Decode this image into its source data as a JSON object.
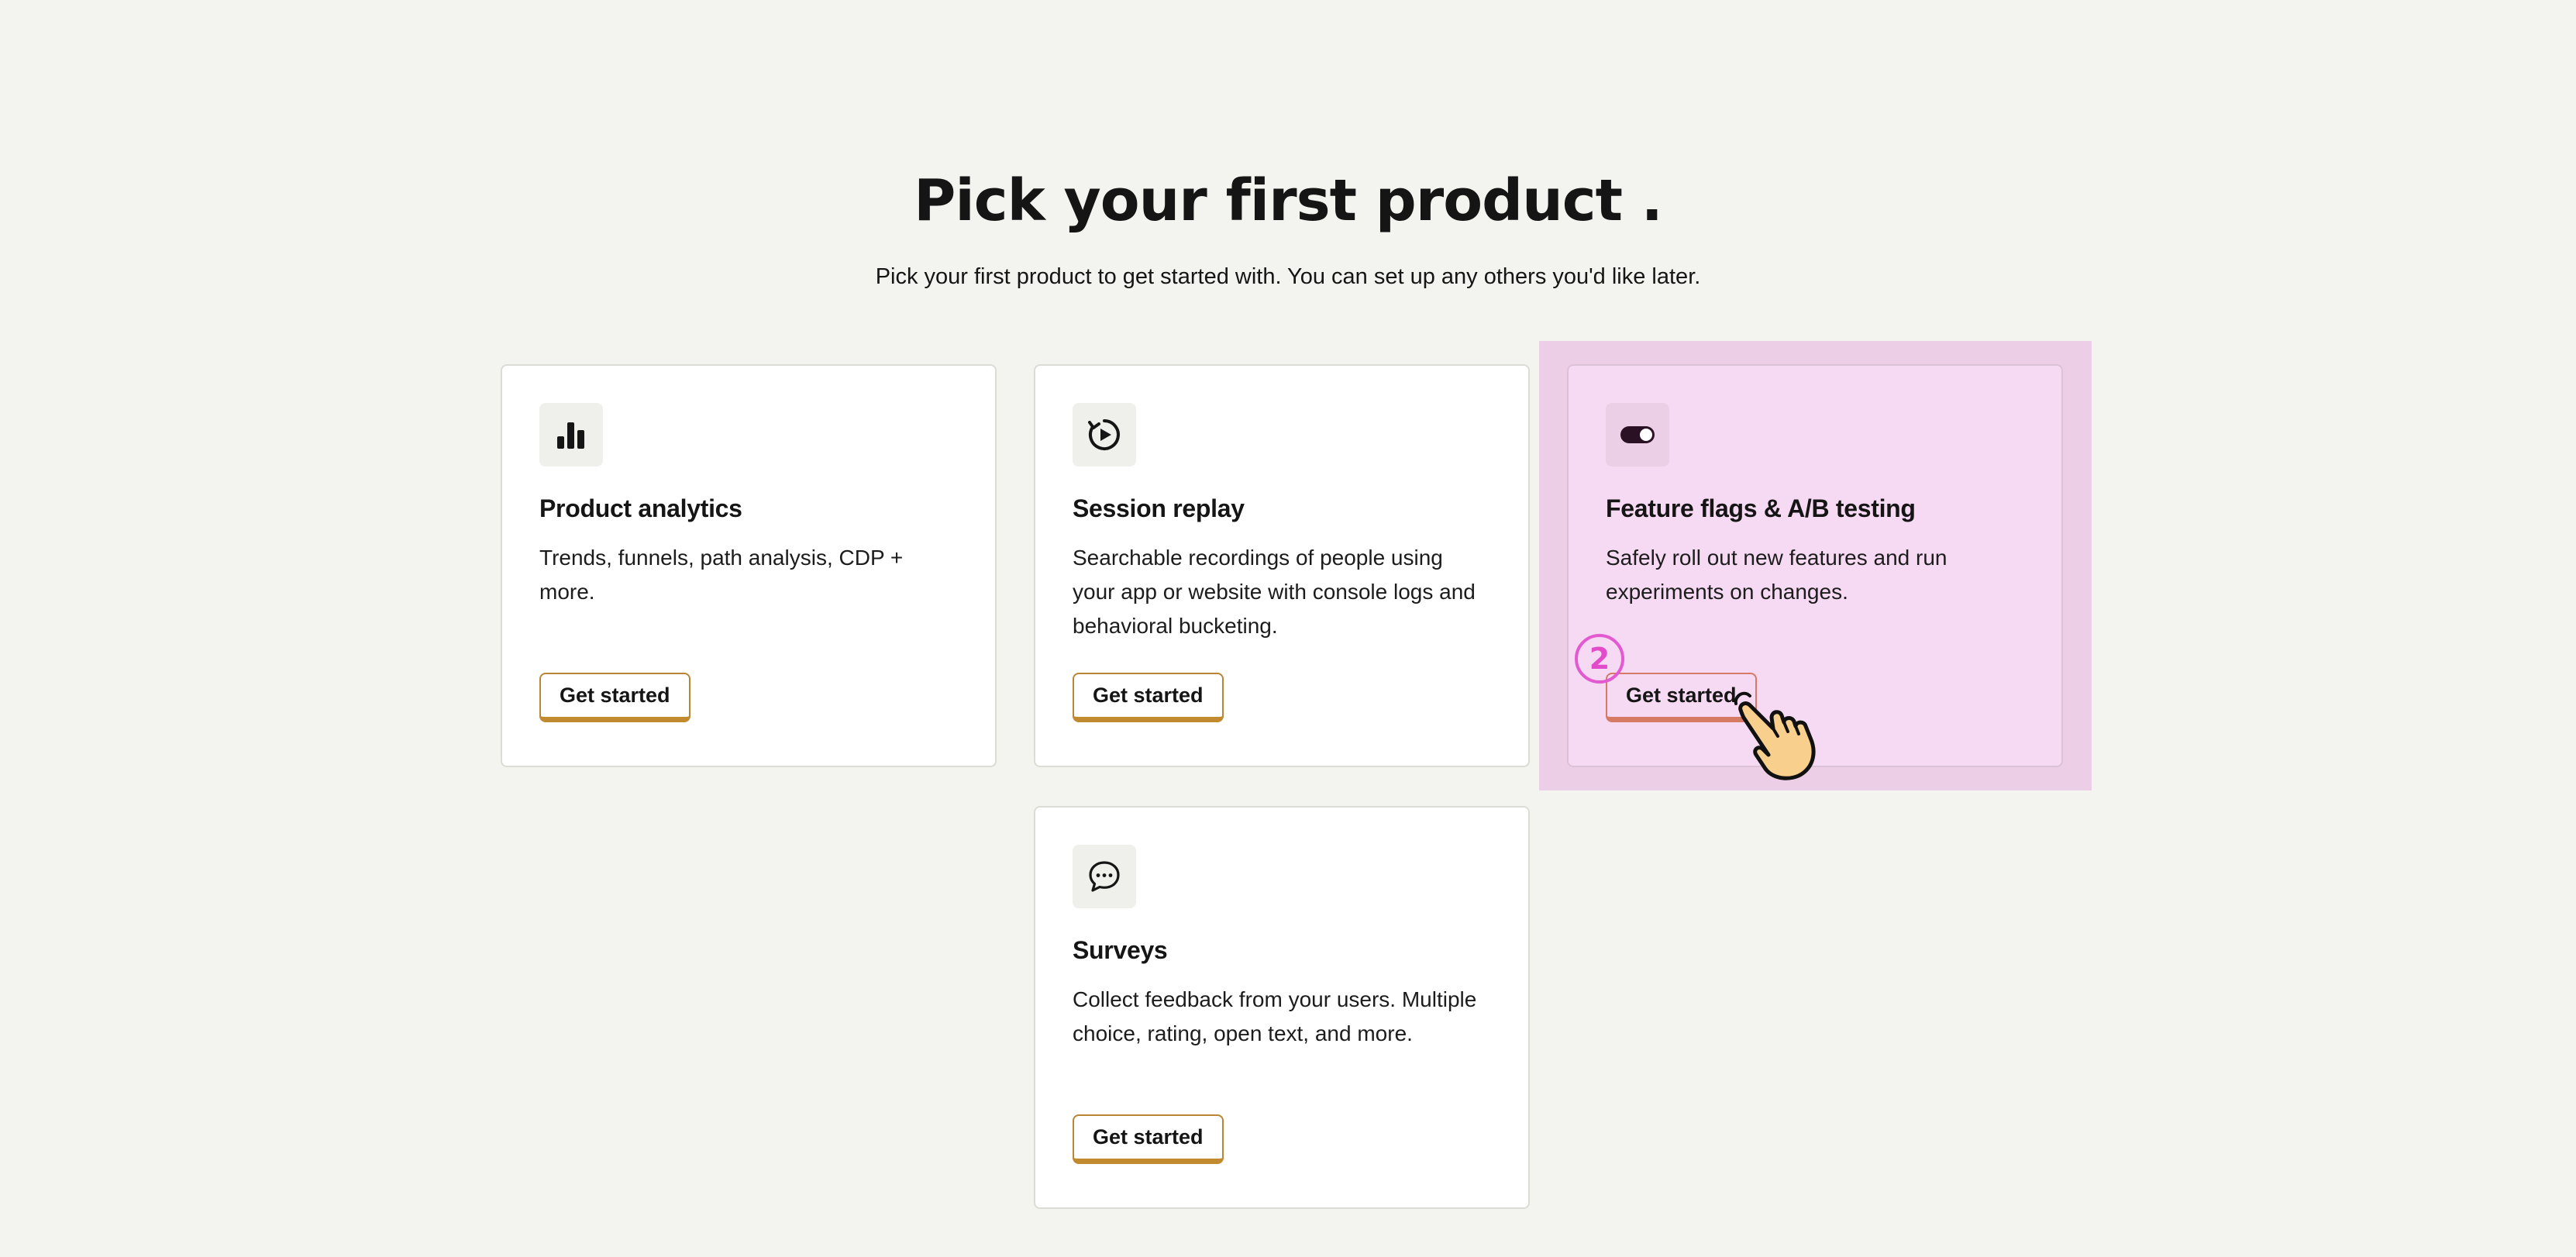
{
  "header": {
    "title": "Pick your first product .",
    "subtitle": "Pick your first product to get started with. You can set up any others you'd like later."
  },
  "products": [
    {
      "icon": "bar-chart-icon",
      "title": "Product analytics",
      "description": "Trends, funnels, path analysis, CDP + more.",
      "button_label": "Get started"
    },
    {
      "icon": "replay-icon",
      "title": "Session replay",
      "description": "Searchable recordings of people using your app or website with console logs and behavioral bucketing.",
      "button_label": "Get started"
    },
    {
      "icon": "toggle-icon",
      "title": "Feature flags & A/B testing",
      "description": "Safely roll out new features and run experiments on changes.",
      "button_label": "Get started",
      "highlighted": true
    },
    {
      "icon": "chat-bubble-icon",
      "title": "Surveys",
      "description": "Collect feedback from your users. Multiple choice, rating, open text, and more.",
      "button_label": "Get started"
    }
  ],
  "annotation": {
    "step_number": "2",
    "pointer_icon": "hand-pointer-icon"
  },
  "colors": {
    "background": "#f3f3ef",
    "highlight": "#eccfe7",
    "selected_card": "#f6d9f2",
    "button_accent": "#c28a2e",
    "step_badge": "#e24ccb"
  }
}
